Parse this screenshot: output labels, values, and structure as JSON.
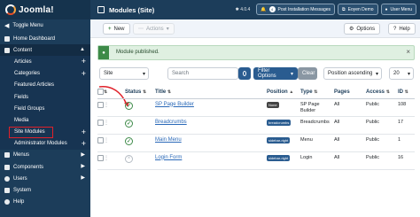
{
  "brand": {
    "logo_text": "Joomla!"
  },
  "sidebar": {
    "toggle_label": "Toggle Menu",
    "items": [
      {
        "label": "Home Dashboard"
      },
      {
        "label": "Content"
      },
      {
        "label": "Articles"
      },
      {
        "label": "Categories"
      },
      {
        "label": "Featured Articles"
      },
      {
        "label": "Fields"
      },
      {
        "label": "Field Groups"
      },
      {
        "label": "Media"
      },
      {
        "label": "Site Modules"
      },
      {
        "label": "Administrator Modules"
      },
      {
        "label": "Menus"
      },
      {
        "label": "Components"
      },
      {
        "label": "Users"
      },
      {
        "label": "System"
      },
      {
        "label": "Help"
      }
    ]
  },
  "topbar": {
    "title": "Modules (Site)",
    "version": "4.0.4",
    "notif_count": "4",
    "notif_label": "Post Installation Messages",
    "site_label": "Eoyen Demo",
    "user_label": "User Menu"
  },
  "toolbar": {
    "new_label": "New",
    "actions_label": "Actions",
    "options_label": "Options",
    "help_label": "Help"
  },
  "message": {
    "text": "Module published."
  },
  "filters": {
    "site_select": "Site",
    "search_placeholder": "Search",
    "filter_options_label": "Filter Options",
    "clear_label": "Clear",
    "ordering": "Position ascending",
    "limit": "20"
  },
  "colors": {
    "sidebar_bg": "#1c3d5a",
    "primary_btn": "#2a5c90",
    "success": "#3d8a48",
    "highlight": "#e0212a",
    "link": "#2a69b8"
  },
  "table": {
    "headers": {
      "status": "Status",
      "title": "Title",
      "position": "Position",
      "type": "Type",
      "pages": "Pages",
      "access": "Access",
      "id": "ID"
    },
    "rows": [
      {
        "title": "SP Page Builder",
        "position": "None",
        "type": "SP Page Builder",
        "pages": "All",
        "access": "Public",
        "id": "108",
        "published": true
      },
      {
        "title": "Breadcrumbs",
        "position": "breadcrumbs",
        "type": "Breadcrumbs",
        "pages": "All",
        "access": "Public",
        "id": "17",
        "published": true
      },
      {
        "title": "Main Menu",
        "position": "sidebar-right",
        "type": "Menu",
        "pages": "All",
        "access": "Public",
        "id": "1",
        "published": true
      },
      {
        "title": "Login Form",
        "position": "sidebar-right",
        "type": "Login",
        "pages": "All",
        "access": "Public",
        "id": "16",
        "published": false
      }
    ]
  }
}
